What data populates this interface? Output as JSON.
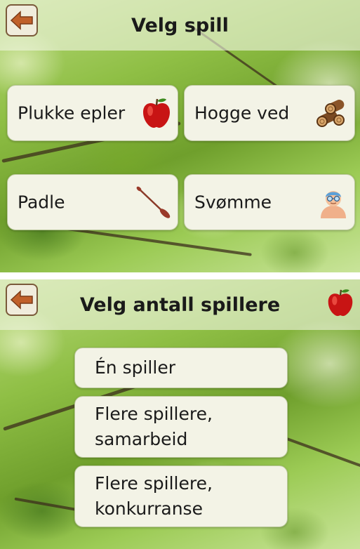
{
  "select_game": {
    "title": "Velg spill",
    "games": [
      {
        "label": "Plukke epler",
        "icon": "apple-icon"
      },
      {
        "label": "Hogge ved",
        "icon": "firewood-icon"
      },
      {
        "label": "Padle",
        "icon": "paddle-icon"
      },
      {
        "label": "Svømme",
        "icon": "swimmer-icon"
      }
    ]
  },
  "select_players": {
    "title": "Velg antall spillere",
    "selected_game_icon": "apple-icon",
    "options": [
      {
        "line1": "Én spiller",
        "line2": ""
      },
      {
        "line1": "Flere spillere,",
        "line2": "samarbeid"
      },
      {
        "line1": "Flere spillere,",
        "line2": "konkurranse"
      }
    ]
  },
  "colors": {
    "back_arrow": "#c0602a",
    "tile_background": "#f3f3e6",
    "header_overlay": "#f0f5e2"
  }
}
